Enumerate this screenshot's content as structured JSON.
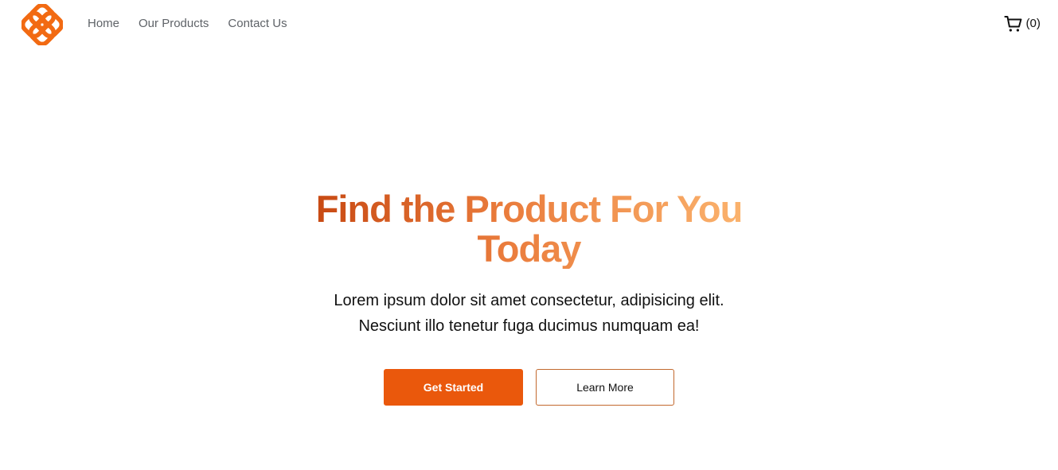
{
  "nav": {
    "logo_icon": "four-petal-logo-icon",
    "links": [
      {
        "label": "Home"
      },
      {
        "label": "Our Products"
      },
      {
        "label": "Contact Us"
      }
    ],
    "cart": {
      "icon": "shopping-cart-icon",
      "count_text": "(0)"
    }
  },
  "hero": {
    "title": "Find the Product For You Today",
    "subtitle": "Lorem ipsum dolor sit amet consectetur, adipisicing elit. Nesciunt illo tenetur fuga ducimus numquam ea!",
    "primary_button": "Get Started",
    "secondary_button": "Learn More"
  },
  "colors": {
    "accent": "#ea580c",
    "gradient_start": "#c2410c",
    "gradient_end": "#fdba74",
    "nav_text": "#5f6368"
  }
}
